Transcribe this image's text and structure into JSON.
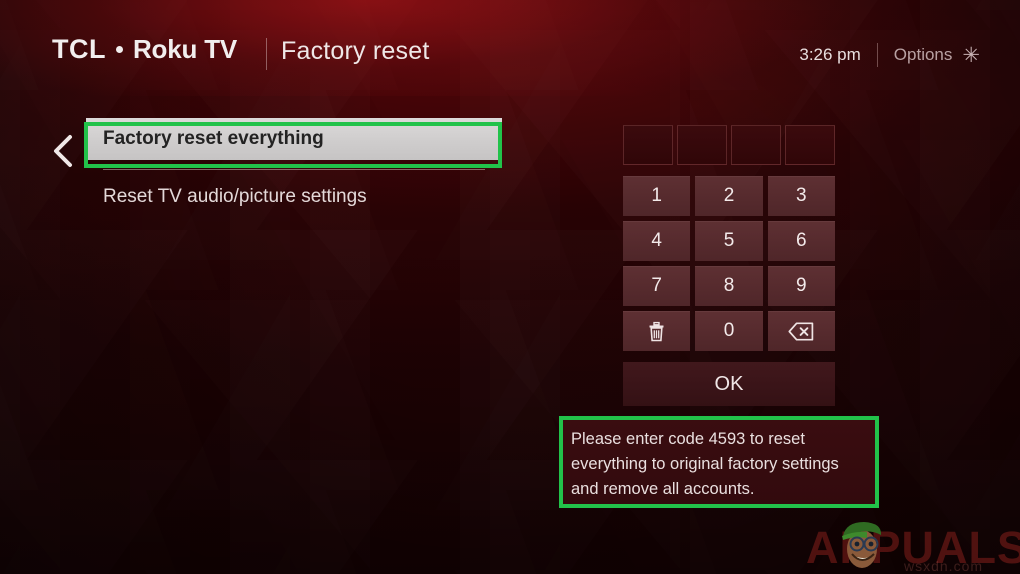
{
  "header": {
    "brand_tcl": "TCL",
    "brand_dot": "•",
    "brand_roku": "Roku TV",
    "title": "Factory reset",
    "clock": "3:26 pm",
    "options_label": "Options",
    "options_star": "✳"
  },
  "menu": {
    "back_icon": "chevron-left-icon",
    "items": [
      {
        "label": "Factory reset everything",
        "selected": true
      },
      {
        "label": "Reset TV audio/picture settings",
        "selected": false
      }
    ]
  },
  "keypad": {
    "code_boxes": [
      "",
      "",
      "",
      ""
    ],
    "keys": [
      {
        "label": "1",
        "kind": "digit"
      },
      {
        "label": "2",
        "kind": "digit"
      },
      {
        "label": "3",
        "kind": "digit"
      },
      {
        "label": "4",
        "kind": "digit"
      },
      {
        "label": "5",
        "kind": "digit"
      },
      {
        "label": "6",
        "kind": "digit"
      },
      {
        "label": "7",
        "kind": "digit"
      },
      {
        "label": "8",
        "kind": "digit"
      },
      {
        "label": "9",
        "kind": "digit"
      },
      {
        "label": "",
        "kind": "trash-icon"
      },
      {
        "label": "0",
        "kind": "digit"
      },
      {
        "label": "",
        "kind": "backspace-icon"
      }
    ],
    "ok_label": "OK"
  },
  "note": {
    "text": "Please enter code 4593 to reset everything to original factory settings and remove all accounts.",
    "code": "4593"
  },
  "watermark": {
    "text": "APPUALS",
    "sub": "wsxdn.com"
  },
  "colors": {
    "background": "#230305",
    "header_glow": "#9b1216",
    "accent_green": "#22c24a",
    "key_face": "#572b2e",
    "selected_bg": "#cfcdcd",
    "text_light": "#efe7e7"
  }
}
